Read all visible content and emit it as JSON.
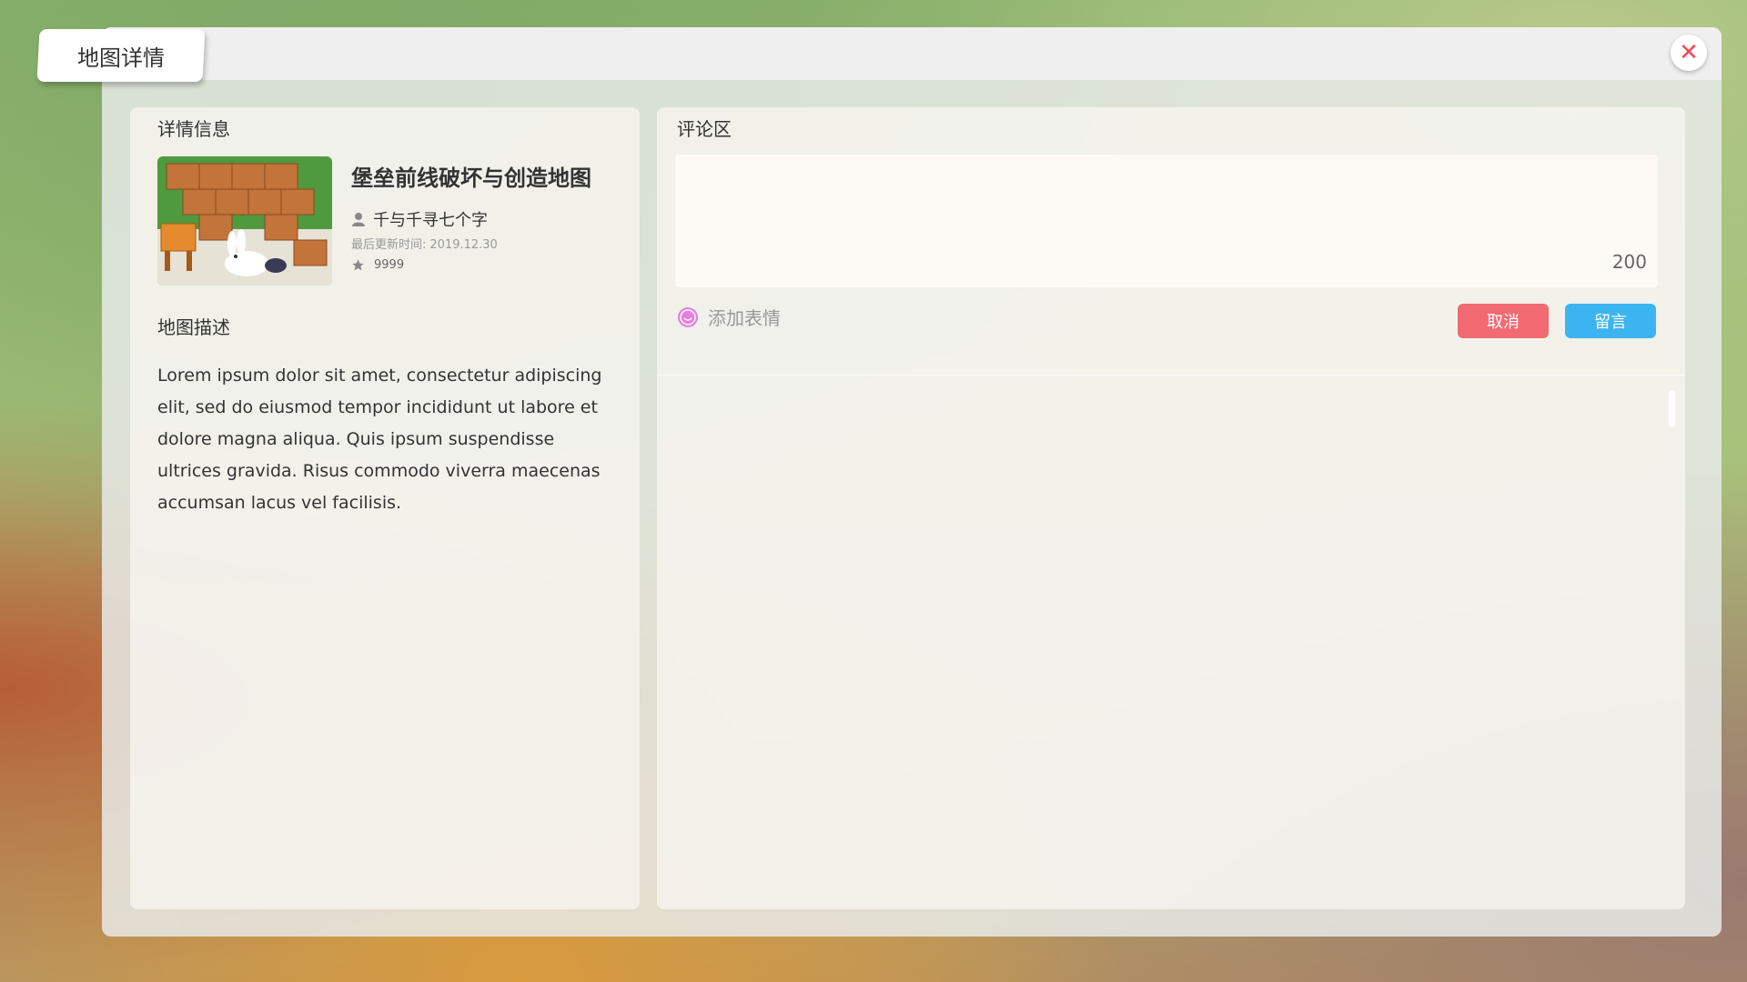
{
  "window": {
    "title": "地图详情",
    "close_label": "✕"
  },
  "details": {
    "section_title": "详情信息",
    "map_name": "堡垒前线破坏与创造地图",
    "author": "千与千寻七个字",
    "updated_label": "最后更新时间:",
    "updated_date": "2019.12.30",
    "star_count": "9999",
    "description_title": "地图描述",
    "description": "Lorem ipsum dolor sit amet, consectetur adipiscing elit, sed do eiusmod tempor incididunt ut labore et dolore magna aliqua. Quis ipsum suspendisse ultrices gravida. Risus commodo viverra maecenas accumsan lacus vel facilisis."
  },
  "comments": {
    "section_title": "评论区",
    "char_limit": "200",
    "emoji_label": "添加表情",
    "cancel_label": "取消",
    "post_label": "留言"
  },
  "icons": {
    "close": "close-icon",
    "user": "user-icon",
    "star": "star-icon",
    "emoji": "emoji-icon"
  },
  "colors": {
    "text_primary": "#333333",
    "text_secondary": "#666666",
    "text_placeholder": "#999999",
    "cancel": "#f26b72",
    "post": "#3db4f2",
    "close": "#ef4a5a"
  }
}
